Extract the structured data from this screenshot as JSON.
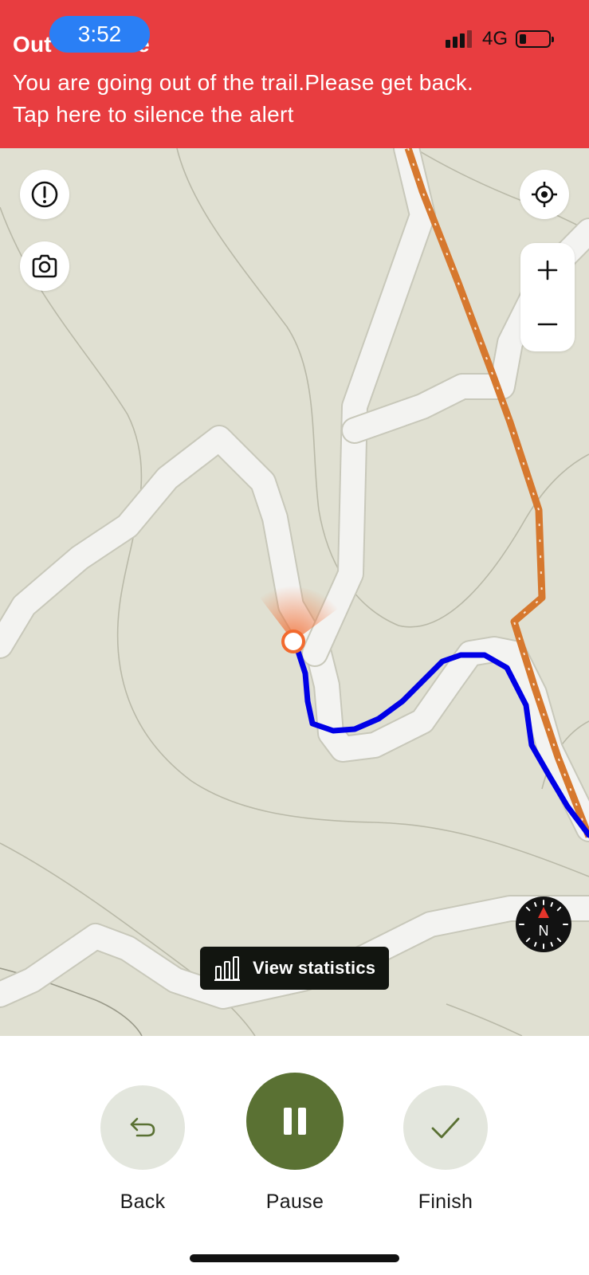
{
  "status_bar": {
    "time": "3:52",
    "network": "4G"
  },
  "alert": {
    "title": "Out of Route",
    "message": "You are going out of the trail.Please get back.",
    "action": "Tap here to silence the alert"
  },
  "map": {
    "compass_label": "N",
    "stats_button_label": "View statistics",
    "colors": {
      "background": "#e0e0d2",
      "road": "#f3f3f1",
      "planned_trail": "#d6782e",
      "recorded_track": "#0000e6",
      "current_position": "#f26a2e"
    }
  },
  "controls": {
    "back_label": "Back",
    "pause_label": "Pause",
    "finish_label": "Finish",
    "accent_color": "#5a7133"
  },
  "icons": [
    "info-icon",
    "camera-icon",
    "locate-icon",
    "zoom-in-icon",
    "zoom-out-icon",
    "compass-icon",
    "bar-chart-icon",
    "undo-icon",
    "pause-icon",
    "check-icon"
  ]
}
